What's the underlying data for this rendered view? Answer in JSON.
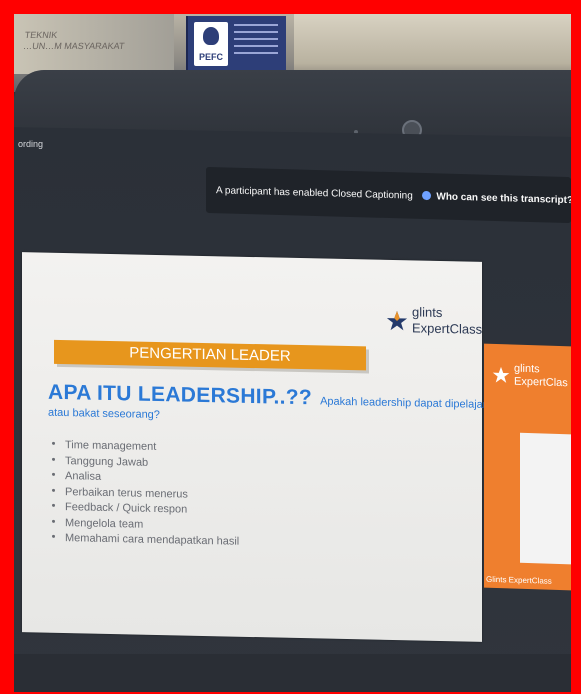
{
  "shelf": {
    "book_left_lines": [
      "TEKNIK",
      "…UN…M MASYARAKAT"
    ],
    "pefc_label": "PEFC"
  },
  "meeting": {
    "recording_label": "ording",
    "cc_banner": {
      "message": "A participant has enabled Closed Captioning",
      "link": "Who can see this transcript? Recording on"
    }
  },
  "slide": {
    "logo": {
      "line1": "glints",
      "line2": "ExpertClass"
    },
    "banner_title": "PENGERTIAN LEADER",
    "heading": "APA ITU LEADERSHIP..??",
    "question_part1": "Apakah leadership dapat dipelajari",
    "question_part2": "atau bakat seseorang?",
    "bullets": [
      "Time management",
      "Tanggung Jawab",
      "Analisa",
      "Perbaikan terus menerus",
      "Feedback / Quick respon",
      "Mengelola team",
      "Memahami cara mendapatkan hasil"
    ]
  },
  "side_tile": {
    "logo": {
      "line1": "glints",
      "line2": "ExpertClas"
    },
    "caption": "Glints ExpertClass"
  },
  "colors": {
    "frame": "#ff0000",
    "banner": "#e7961d",
    "heading": "#2b79d6",
    "tile": "#ef7f2e"
  }
}
